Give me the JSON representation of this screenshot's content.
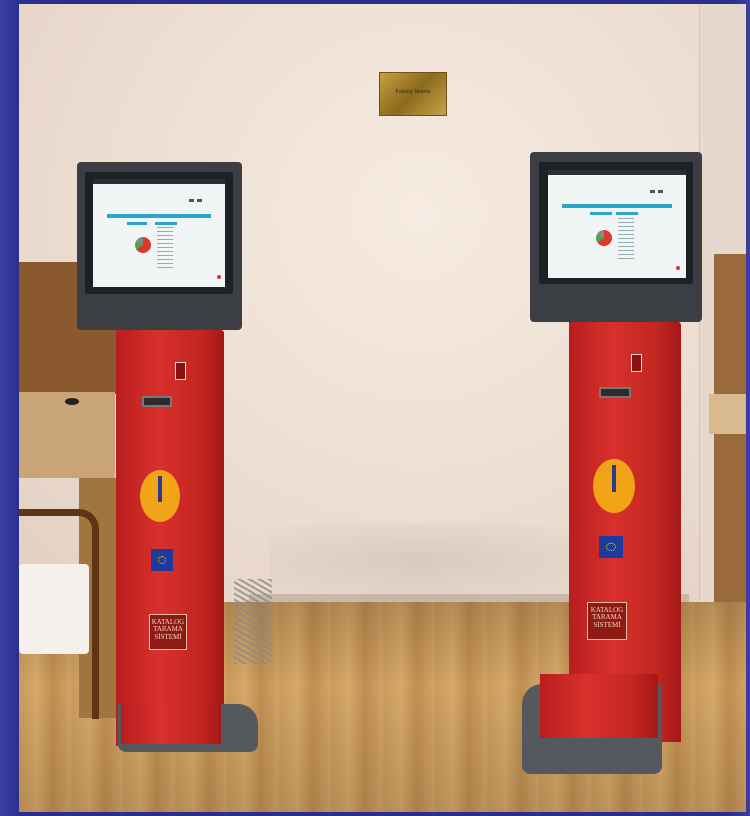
{
  "scene": {
    "description_text": "",
    "wall_sign": {
      "text": "Katalog Tarama"
    }
  },
  "kiosks": [
    {
      "id": "left",
      "panel_text": [
        "KATALOG",
        "TARAMA",
        "SİSTEMİ"
      ]
    },
    {
      "id": "right",
      "panel_text": [
        "KATALOG",
        "TARAMA",
        "SİSTEMİ"
      ]
    }
  ],
  "colors": {
    "kiosk_red": "#d9302c",
    "monitor_gray": "#3b3f43",
    "accent_blue": "#2da7c8",
    "logo_orange": "#f2a419",
    "eu_blue": "#1d3a9c"
  }
}
